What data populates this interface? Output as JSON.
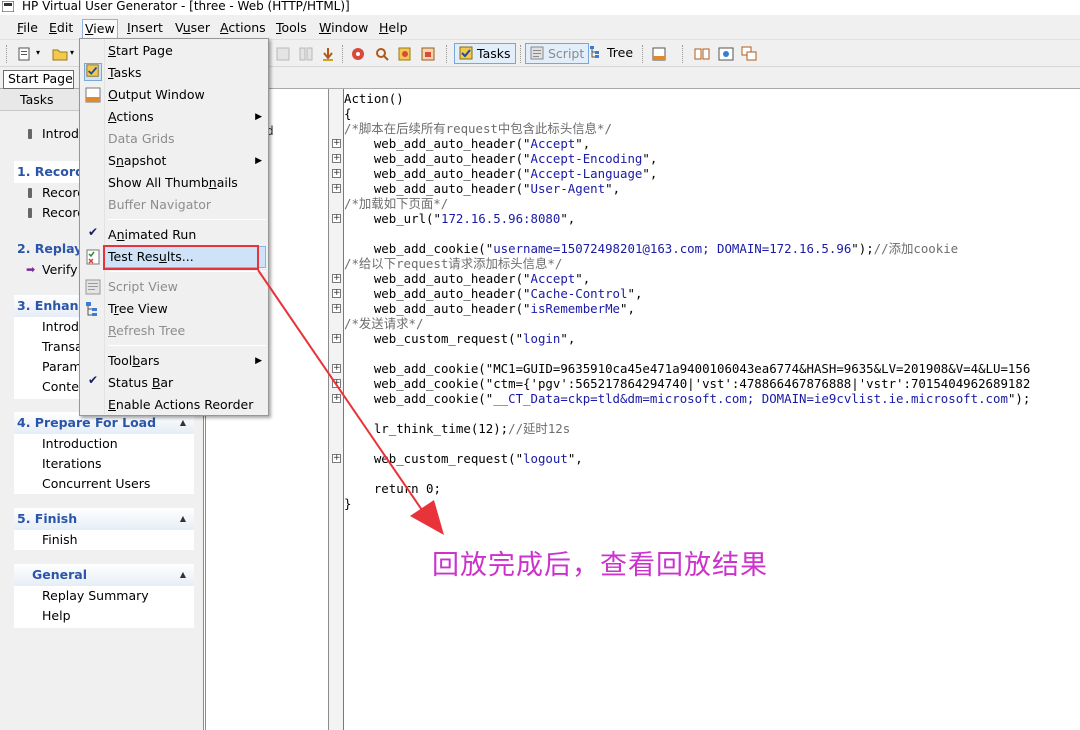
{
  "window": {
    "title": "HP Virtual User Generator - [three - Web (HTTP/HTML)]"
  },
  "menubar": {
    "items": [
      "File",
      "Edit",
      "View",
      "Insert",
      "Vuser",
      "Actions",
      "Tools",
      "Window",
      "Help"
    ]
  },
  "toolbar": {
    "tasks_label": "Tasks",
    "script_label": "Script",
    "tree_label": "Tree"
  },
  "tabs": {
    "start_page": "Start Page"
  },
  "taskpane": {
    "header": "Tasks",
    "intro_partial": "Introdu",
    "group1": {
      "title": "1. Recordi",
      "items": [
        "Record",
        "Record"
      ]
    },
    "group2": {
      "title": "2. Replay",
      "items": [
        "Verify"
      ]
    },
    "group3": {
      "title": "3. Enhanc",
      "items": [
        "Introd",
        "Transa",
        "Parame",
        "Conter"
      ]
    },
    "group4": {
      "title": "4. Prepare For Load",
      "items": [
        "Introduction",
        "Iterations",
        "Concurrent Users"
      ]
    },
    "group5": {
      "title": "5. Finish",
      "items": [
        "Finish"
      ]
    },
    "group6": {
      "title": "General",
      "items": [
        "Replay Summary",
        "Help"
      ]
    }
  },
  "tree_stub": {
    "d": "d"
  },
  "view_menu": {
    "items": [
      {
        "label": "Start Page"
      },
      {
        "label": "Tasks"
      },
      {
        "label": "Output Window"
      },
      {
        "label": "Actions"
      },
      {
        "label": "Data Grids"
      },
      {
        "label": "Snapshot"
      },
      {
        "label": "Show All Thumbnails"
      },
      {
        "label": "Buffer Navigator"
      },
      {
        "label": "Animated Run"
      },
      {
        "label": "Test Results..."
      },
      {
        "label": "Script View"
      },
      {
        "label": "Tree View"
      },
      {
        "label": "Refresh Tree"
      },
      {
        "label": "Toolbars"
      },
      {
        "label": "Status Bar"
      },
      {
        "label": "Enable Actions Reorder"
      }
    ]
  },
  "code": {
    "lines": [
      "Action()",
      "{",
      "/*脚本在后续所有request中包含此标头信息*/",
      "    web_add_auto_header(\"Accept\",",
      "    web_add_auto_header(\"Accept-Encoding\",",
      "    web_add_auto_header(\"Accept-Language\",",
      "    web_add_auto_header(\"User-Agent\",",
      "/*加载如下页面*/",
      "    web_url(\"172.16.5.96:8080\",",
      "",
      "    web_add_cookie(\"username=15072498201@163.com; DOMAIN=172.16.5.96\");//添加cookie",
      "/*给以下request请求添加标头信息*/",
      "    web_add_auto_header(\"Accept\",",
      "    web_add_auto_header(\"Cache-Control\",",
      "    web_add_auto_header(\"isRememberMe\",",
      "/*发送请求*/",
      "    web_custom_request(\"login\",",
      "",
      "    web_add_cookie(\"MC1=GUID=9635910ca45e471a9400106043ea6774&HASH=9635&LV=201908&V=4&LU=156",
      "    web_add_cookie(\"ctm={'pgv':565217864294740|'vst':478866467876888|'vstr':7015404962689182",
      "    web_add_cookie(\"__CT_Data=ckp=tld&dm=microsoft.com; DOMAIN=ie9cvlist.ie.microsoft.com\");",
      "",
      "    lr_think_time(12);//延时12s",
      "",
      "    web_custom_request(\"logout\",",
      "",
      "    return 0;",
      "}"
    ]
  },
  "annotation": {
    "text": "回放完成后，查看回放结果",
    "color": "#cc33cc",
    "arrow_color": "#e8333a"
  }
}
